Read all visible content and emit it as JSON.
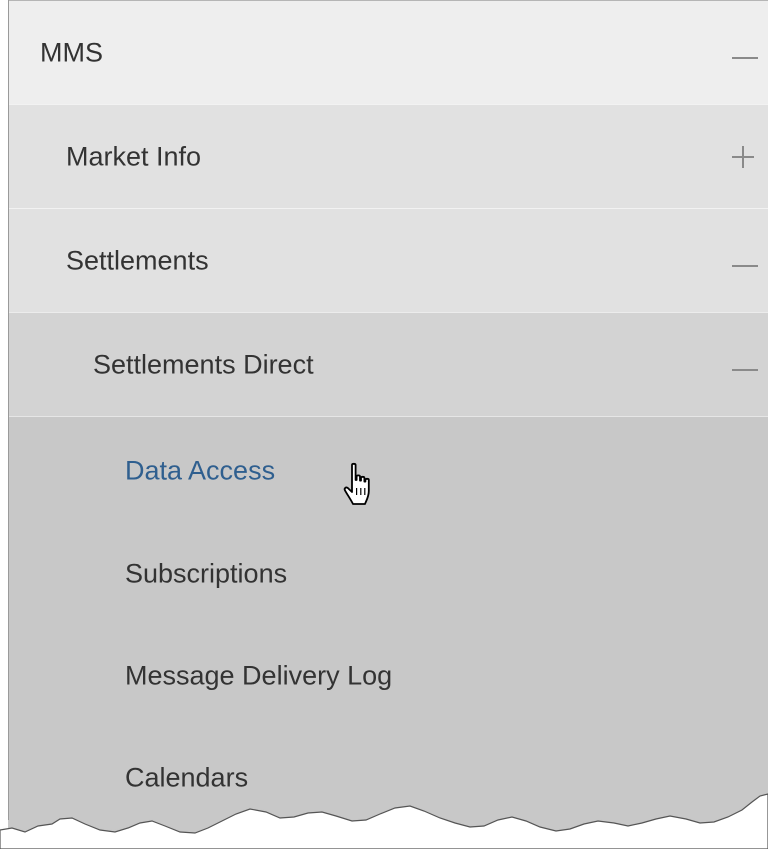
{
  "menu": {
    "root": {
      "label": "MMS",
      "toggle": "collapse"
    },
    "market_info": {
      "label": "Market Info",
      "toggle": "expand"
    },
    "settlements": {
      "label": "Settlements",
      "toggle": "collapse"
    },
    "settlements_direct": {
      "label": "Settlements Direct",
      "toggle": "collapse"
    },
    "leaves": [
      {
        "label": "Data Access",
        "state": "hover"
      },
      {
        "label": "Subscriptions"
      },
      {
        "label": "Message Delivery Log"
      },
      {
        "label": "Calendars"
      }
    ]
  },
  "colors": {
    "link_hover": "#2f5f8f",
    "text": "#333333",
    "toggle": "#8a8a8a"
  }
}
